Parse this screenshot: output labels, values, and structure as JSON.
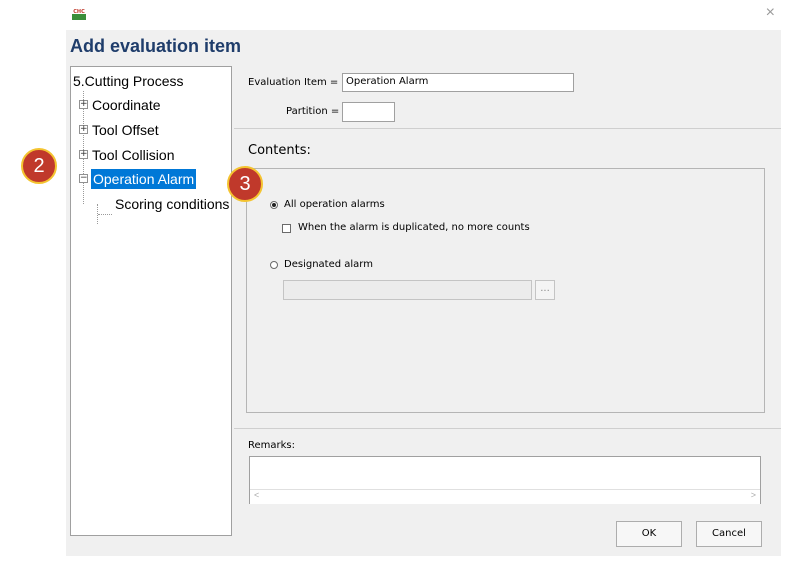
{
  "window": {
    "close_glyph": "×",
    "title": "Add evaluation item"
  },
  "tree": {
    "root": "5.Cutting Process",
    "items": [
      {
        "label": "Coordinate",
        "expander": "+"
      },
      {
        "label": "Tool Offset",
        "expander": "+"
      },
      {
        "label": "Tool Collision",
        "expander": "+"
      },
      {
        "label": "Operation Alarm",
        "expander": "−",
        "selected": true
      }
    ],
    "child": "Scoring conditions"
  },
  "form": {
    "evaluation_item_label": "Evaluation Item =",
    "evaluation_item_value": "Operation Alarm",
    "partition_label": "Partition =",
    "partition_value": ""
  },
  "contents": {
    "label": "Contents:",
    "option_all": "All operation alarms",
    "option_all_selected": true,
    "checkbox_duplicate": "When the alarm is duplicated, no more counts",
    "checkbox_duplicate_checked": false,
    "option_designated": "Designated alarm",
    "designated_value": "",
    "browse_label": "..."
  },
  "remarks": {
    "label": "Remarks:",
    "value": "",
    "scroll_left": "<",
    "scroll_right": ">"
  },
  "buttons": {
    "ok": "OK",
    "cancel": "Cancel"
  },
  "annotations": {
    "badge_2": "2",
    "badge_3": "3",
    "color_fill": "#c0392b",
    "color_border": "#f4c430"
  },
  "colors": {
    "selection": "#0078d7",
    "heading": "#1f3d6b",
    "dialog_bg": "#f0f0f0"
  }
}
